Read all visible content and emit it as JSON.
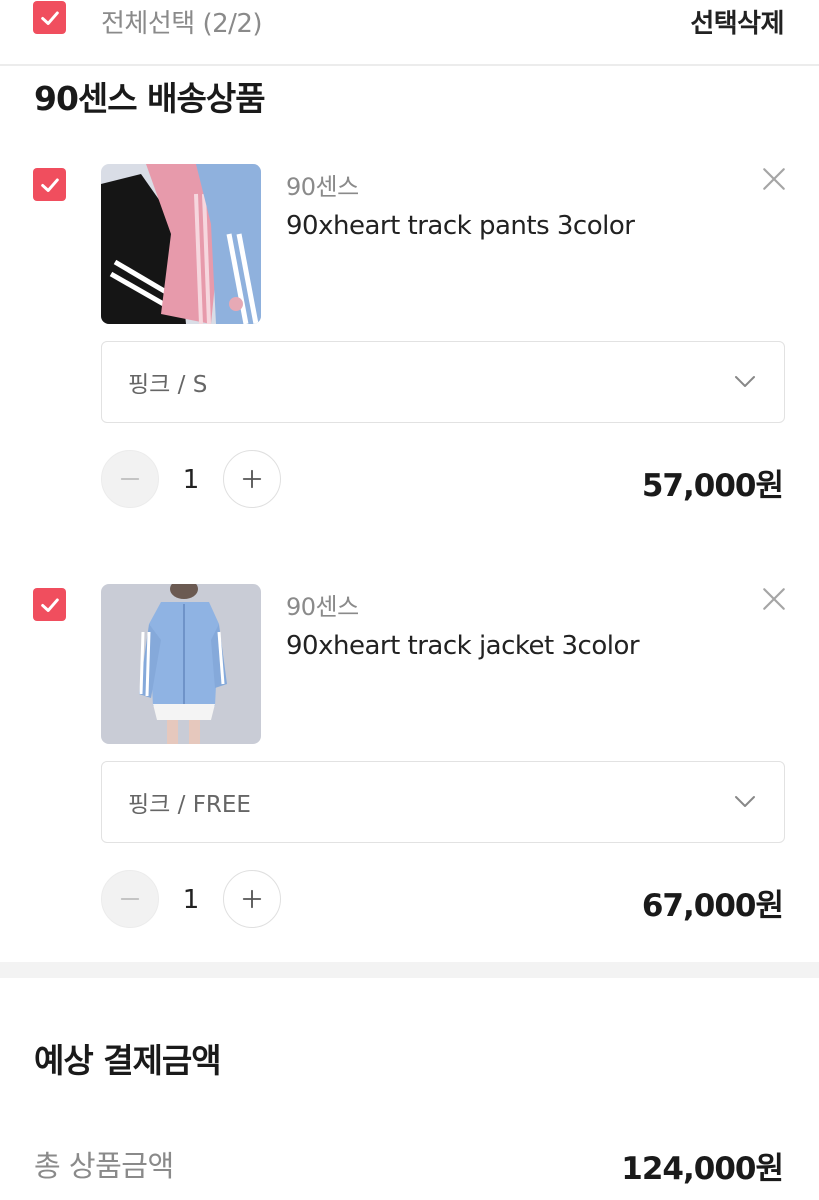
{
  "header": {
    "select_all_label": "전체선택 (2/2)",
    "delete_selected_label": "선택삭제"
  },
  "section": {
    "title": "90센스 배송상품"
  },
  "items": [
    {
      "brand": "90센스",
      "name": "90xheart track pants 3color",
      "option": "핑크 / S",
      "quantity": "1",
      "price": "57,000원",
      "thumbnail": "track-pants-photo"
    },
    {
      "brand": "90센스",
      "name": "90xheart track jacket 3color",
      "option": "핑크 / FREE",
      "quantity": "1",
      "price": "67,000원",
      "thumbnail": "track-jacket-photo"
    }
  ],
  "summary": {
    "title": "예상 결제금액",
    "total_label": "총 상품금액",
    "total_value": "124,000원"
  },
  "colors": {
    "accent": "#f04e5e",
    "text_primary": "#1a1a1a",
    "text_secondary": "#8a8a8a",
    "border": "#e2e2e2"
  },
  "icons": [
    "check-icon",
    "close-icon",
    "chevron-down-icon",
    "minus-icon",
    "plus-icon"
  ]
}
